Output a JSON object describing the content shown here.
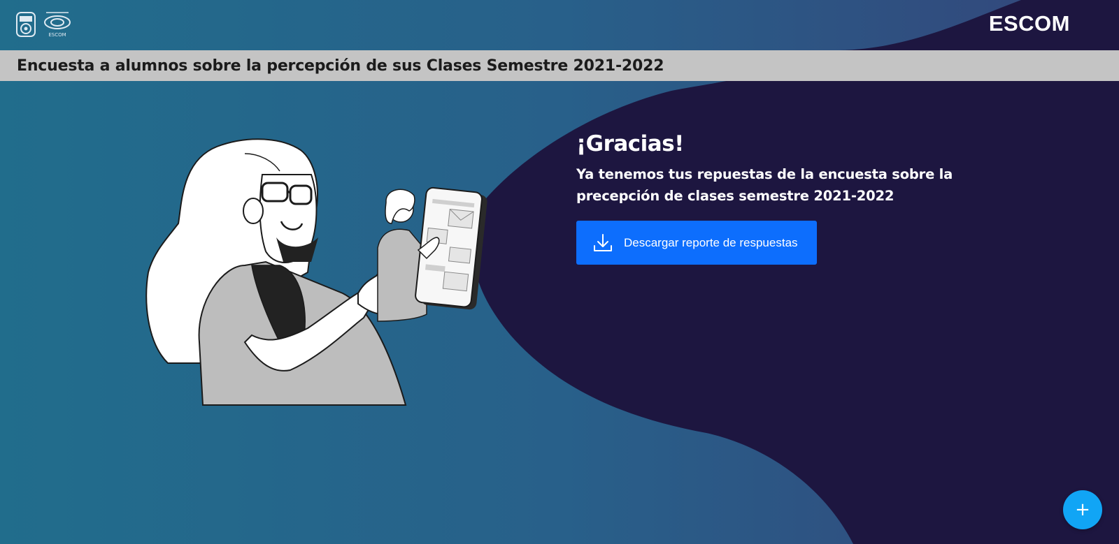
{
  "header": {
    "brand": "ESCOM",
    "logo_left": "ipn-logo",
    "logo_right": "escom-logo",
    "logo_right_text": "ESCOM"
  },
  "title_bar": {
    "title": "Encuesta a alumnos sobre la percepción de sus Clases Semestre 2021-2022"
  },
  "main": {
    "heading": "¡Gracias!",
    "message": "Ya tenemos tus repuestas de la encuesta sobre la precepción de clases semestre 2021-2022",
    "download_button": {
      "label": "Descargar reporte de respuestas",
      "icon": "download-icon"
    }
  },
  "fab": {
    "label": "+",
    "icon": "plus-icon"
  },
  "colors": {
    "background_teal": "#236b8e",
    "background_navy": "#1d1640",
    "title_bar": "#c4c4c4",
    "button_blue": "#0d6efd",
    "fab_blue": "#11a5f5"
  }
}
